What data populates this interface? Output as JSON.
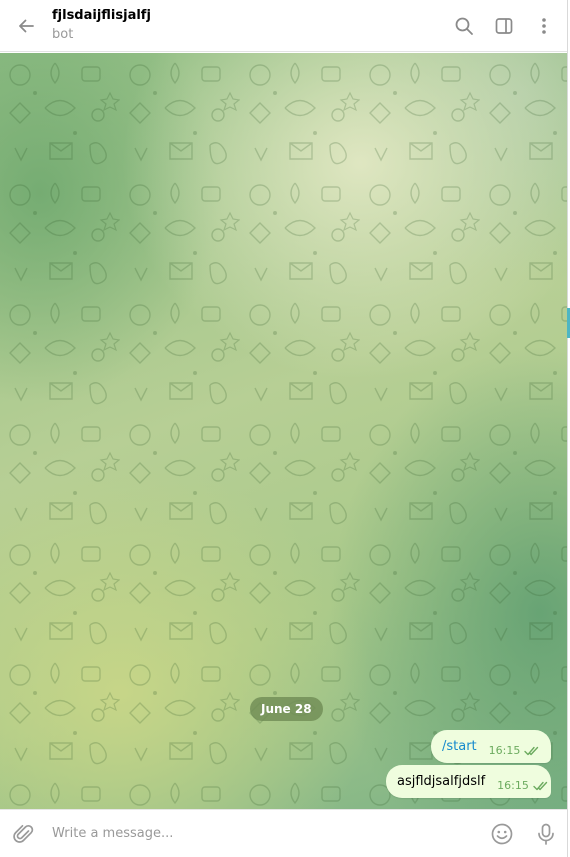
{
  "header": {
    "title": "fjlsdaijflisjalfj",
    "status": "bot",
    "icons": [
      "back-arrow-icon",
      "search-icon",
      "sidebar-toggle-icon",
      "more-vertical-icon"
    ]
  },
  "chat": {
    "date_separator": "June 28",
    "messages": [
      {
        "text": "/start",
        "time": "16:15",
        "status": "read"
      },
      {
        "text": "asjfldjsalfjdslf",
        "time": "16:15",
        "status": "read"
      }
    ]
  },
  "composer": {
    "placeholder": "Write a message...",
    "icons": [
      "paperclip-icon",
      "emoji-icon",
      "microphone-icon"
    ]
  },
  "colors": {
    "outgoing_bubble": "#effdde",
    "time_color": "#6cab5f",
    "command_link": "#168acd",
    "date_pill": "#708c56"
  }
}
